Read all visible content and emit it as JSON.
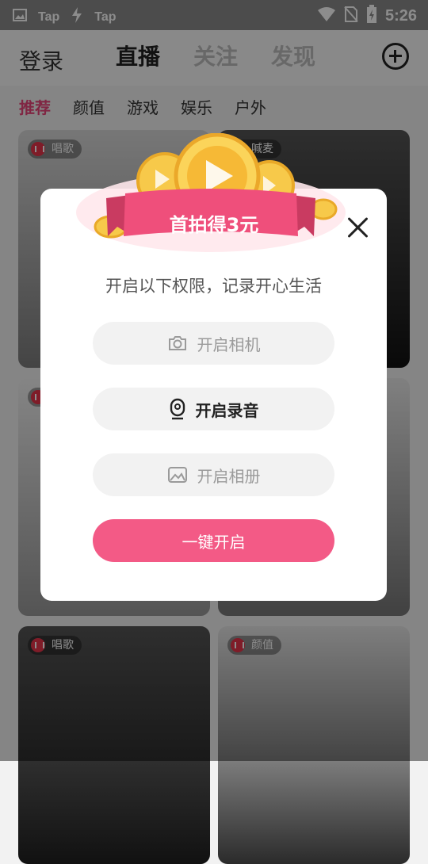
{
  "status_bar": {
    "items": [
      "Tap",
      "Tap"
    ],
    "time": "5:26"
  },
  "header": {
    "login": "登录",
    "tabs": [
      {
        "label": "直播",
        "active": true
      },
      {
        "label": "关注",
        "active": false
      },
      {
        "label": "发现",
        "active": false
      }
    ],
    "add_icon": "plus-circle-icon"
  },
  "categories": [
    {
      "label": "推荐",
      "active": true
    },
    {
      "label": "颜值"
    },
    {
      "label": "游戏"
    },
    {
      "label": "娱乐"
    },
    {
      "label": "户外"
    }
  ],
  "cards": [
    {
      "badge": "唱歌"
    },
    {
      "badge": "喊麦"
    },
    {
      "badge": "唱歌"
    },
    {
      "badge": "颜值"
    }
  ],
  "dialog": {
    "banner_text": "首拍得3元",
    "subtitle": "开启以下权限，记录开心生活",
    "permissions": [
      {
        "label": "开启相机",
        "icon": "camera-icon",
        "state": "dim"
      },
      {
        "label": "开启录音",
        "icon": "microphone-icon",
        "state": "active"
      },
      {
        "label": "开启相册",
        "icon": "image-icon",
        "state": "dim"
      }
    ],
    "primary_button": "一键开启",
    "close_icon": "close-icon"
  },
  "colors": {
    "accent": "#f35a86",
    "banner": "#ef4f7b",
    "coin": "#f7c94a"
  }
}
